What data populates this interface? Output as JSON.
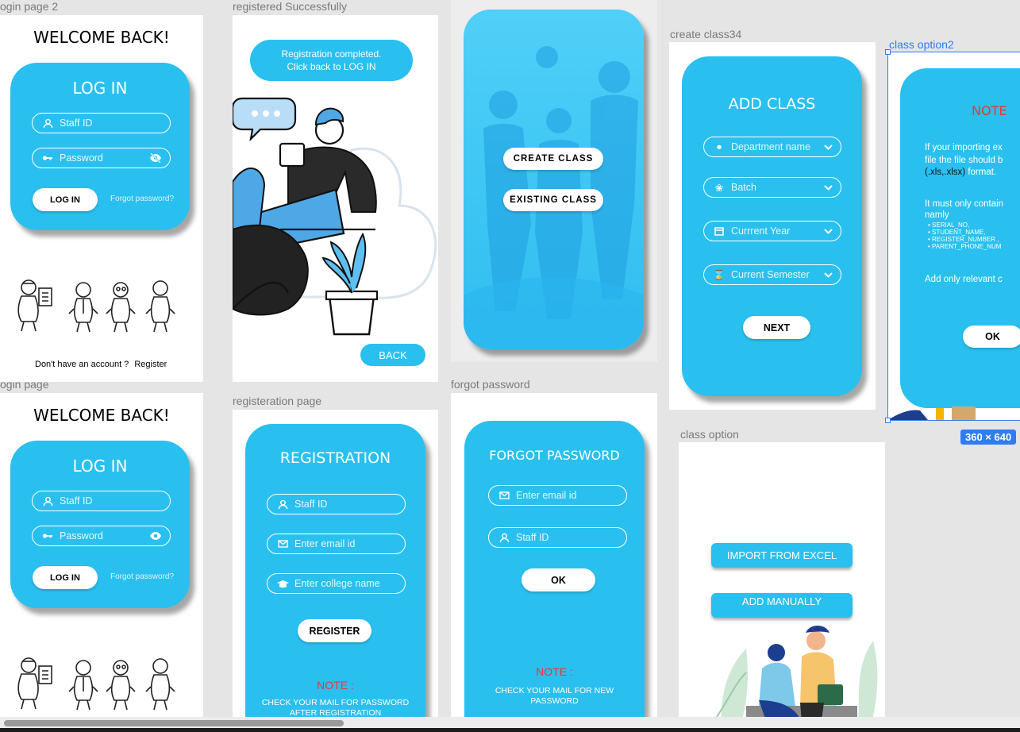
{
  "labels": {
    "login2": "ogin page 2",
    "regsuccess": "registered Successfully",
    "create_class": "create class34",
    "class_option2": "class option2",
    "login": "ogin page",
    "registration": "registeration page",
    "forgot": "forgot password",
    "class_option": "class option"
  },
  "login2": {
    "welcome": "WELCOME BACK!",
    "title": "LOG IN",
    "staff_placeholder": "Staff ID",
    "password_placeholder": "Password",
    "login_btn": "LOG IN",
    "forgot": "Forgot password?",
    "footer_q": "Don't have an account ?",
    "footer_link": "Register"
  },
  "login": {
    "welcome": "WELCOME BACK!",
    "title": "LOG IN",
    "staff_placeholder": "Staff ID",
    "password_placeholder": "Password",
    "login_btn": "LOG IN",
    "forgot": "Forgot password?"
  },
  "regsuccess": {
    "bubble_line1": "Registration completed.",
    "bubble_line2": "Click back to LOG IN",
    "back_btn": "BACK"
  },
  "choose": {
    "create_btn": "CREATE CLASS",
    "existing_btn": "EXISTING CLASS"
  },
  "create_class": {
    "title": "ADD CLASS",
    "dept": "Department name",
    "batch": "Batch",
    "year": "Currrent Year",
    "semester": "Current Semester",
    "next_btn": "NEXT"
  },
  "class_option2": {
    "title": "NOTE",
    "p1_line1": "If your importing ex",
    "p1_line2": "file the file should b",
    "p1_fmt": "(.xls,.xlsx)",
    "p1_fmt_rest": "format.",
    "p2_line1": "It must only contain",
    "p2_line2": "namly",
    "items": [
      "SERIAL_NO,",
      "STUDENT_NAME,",
      "REGISTER_NUMBER ,",
      "PARENT_PHONE_NUM"
    ],
    "p3": "Add only relevant c",
    "ok_btn": "OK",
    "size_badge": "360 × 640"
  },
  "registration": {
    "title": "REGISTRATION",
    "staff": "Staff ID",
    "email": "Enter email id",
    "college": "Enter college name",
    "register_btn": "REGISTER",
    "note_title": "NOTE :",
    "note_line1": "CHECK YOUR MAIL FOR PASSWORD",
    "note_line2": "AFTER REGISTRATION"
  },
  "forgot": {
    "title": "FORGOT PASSWORD",
    "email": "Enter email id",
    "staff": "Staff ID",
    "ok_btn": "OK",
    "note_title": "NOTE :",
    "note_line1": "CHECK YOUR MAIL FOR NEW",
    "note_line2": "PASSWORD"
  },
  "class_option": {
    "import_btn": "IMPORT FROM EXCEL",
    "manual_btn": "ADD MANUALLY"
  },
  "colors": {
    "primary": "#29c0f0",
    "canvas": "#e5e5e5",
    "selection": "#2f7cf6",
    "note": "#e53935"
  }
}
